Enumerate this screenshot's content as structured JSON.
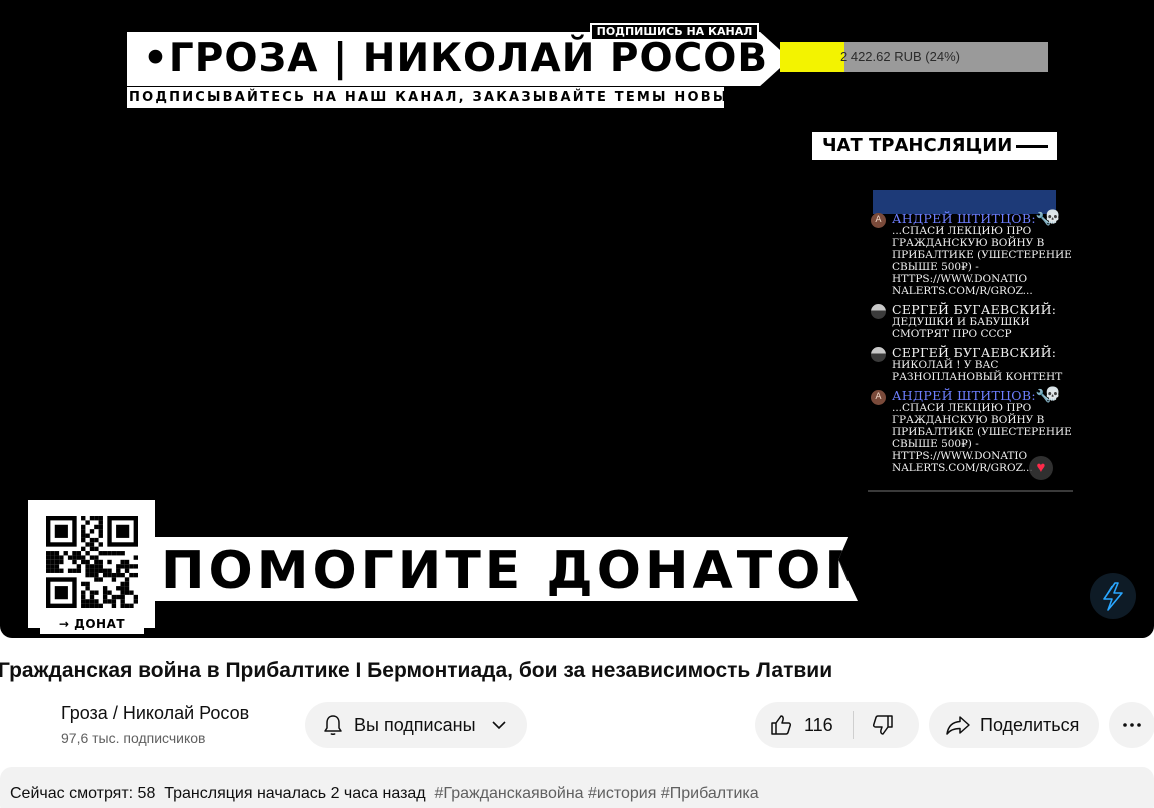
{
  "player": {
    "title_banner": "•ГРОЗА | НИКОЛАЙ РОСОВ",
    "subscribe_tag": "ПОДПИШИСЬ НА КАНАЛ",
    "ticker": "ПОДПИСЫВАЙТЕСЬ НА НАШ КАНАЛ, ЗАКАЗЫВАЙТЕ ТЕМЫ НОВЫ›",
    "goal": {
      "text": "2 422.62 RUB (24%)",
      "fraction": 0.24,
      "fill_color": "#f3f300"
    },
    "chat_header": "ЧАТ ТРАНСЛЯЦИИ",
    "chat_messages": [
      {
        "avatar": "A",
        "author": "АНДРЕЙ ШТИТЦОВ:",
        "badge": "wrench-icon",
        "emoji": "skull-icon",
        "text": "...СПАСИ ЛЕКЦИЮ ПРО ГРАЖДАНСКУЮ ВОЙНУ В ПРИБАЛТИКЕ (УШЕСТЕРЕНИЕ СВЫШЕ 500₽) - HTTPS://WWW.DONATIO NALERTS.COM/R/GROZ..."
      },
      {
        "avatar": "",
        "author": "СЕРГЕЙ БУГАЕВСКИЙ:",
        "text": "ДЕДУШКИ И БАБУШКИ СМОТРЯТ ПРО СССР"
      },
      {
        "avatar": "",
        "author": "СЕРГЕЙ БУГАЕВСКИЙ:",
        "text": "НИКОЛАЙ ! У ВАС РАЗНОПЛАНОВЫЙ КОНТЕНТ"
      },
      {
        "avatar": "A",
        "author": "АНДРЕЙ ШТИТЦОВ:",
        "badge": "wrench-icon",
        "emoji": "skull-icon",
        "text": "...СПАСИ ЛЕКЦИЮ ПРО ГРАЖДАНСКУЮ ВОЙНУ В ПРИБАЛТИКЕ (УШЕСТЕРЕНИЕ СВЫШЕ 500₽) - HTTPS://WWW.DONATIO NALERTS.COM/R/GROZ..."
      }
    ],
    "qr_caption": "→ ДОНАТ",
    "donate_banner": "ПОМОГИТЕ ДОНАТОМ",
    "corner_icon": "lightning-icon"
  },
  "video": {
    "title": "Гражданская война в Прибалтике I Бермонтиада, бои за независимость Латвии",
    "channel": {
      "name": "Гроза / Николай Росов",
      "subscribers": "97,6 тыс. подписчиков"
    },
    "subscribe_label": "Вы подписаны",
    "likes": "116",
    "share_label": "Поделиться",
    "description": {
      "viewers": "Сейчас смотрят: 58",
      "started": "Трансляция началась 2 часа назад",
      "tags": "#Гражданскаявойна #история #Прибалтика"
    }
  }
}
